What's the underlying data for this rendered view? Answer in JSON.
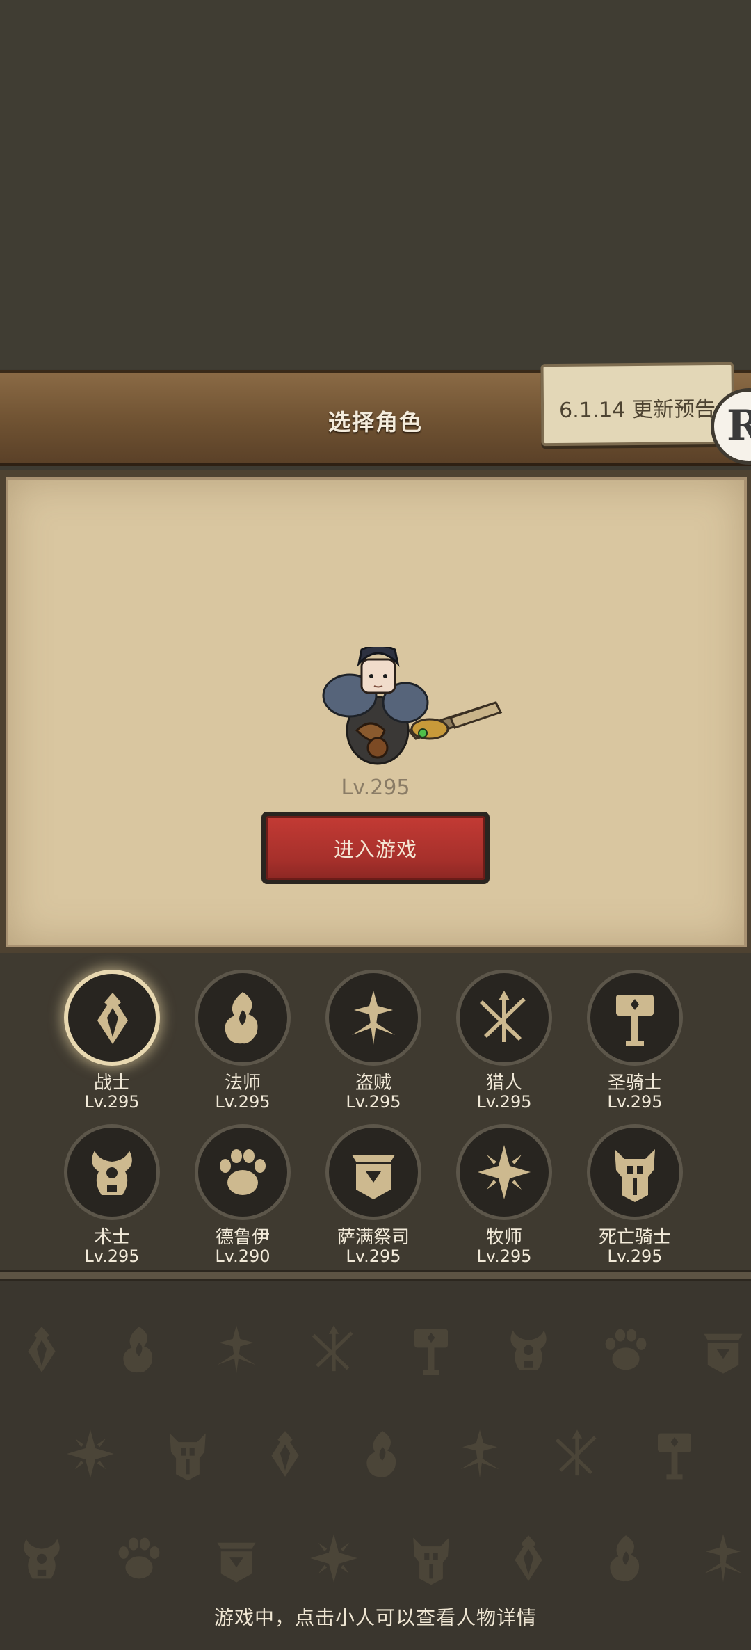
{
  "header": {
    "title": "选择角色"
  },
  "notice": {
    "label": "6.1.14 更新预告"
  },
  "corner_button": {
    "glyph": "R"
  },
  "hero": {
    "level": "Lv.295"
  },
  "enter_button": {
    "label": "进入游戏"
  },
  "classes": [
    {
      "name": "战士",
      "level": "Lv.295",
      "icon": "warrior-icon",
      "selected": true
    },
    {
      "name": "法师",
      "level": "Lv.295",
      "icon": "mage-icon",
      "selected": false
    },
    {
      "name": "盗贼",
      "level": "Lv.295",
      "icon": "rogue-icon",
      "selected": false
    },
    {
      "name": "猎人",
      "level": "Lv.295",
      "icon": "hunter-icon",
      "selected": false
    },
    {
      "name": "圣骑士",
      "level": "Lv.295",
      "icon": "paladin-icon",
      "selected": false
    },
    {
      "name": "术士",
      "level": "Lv.295",
      "icon": "warlock-icon",
      "selected": false
    },
    {
      "name": "德鲁伊",
      "level": "Lv.290",
      "icon": "druid-icon",
      "selected": false
    },
    {
      "name": "萨满祭司",
      "level": "Lv.295",
      "icon": "shaman-icon",
      "selected": false
    },
    {
      "name": "牧师",
      "level": "Lv.295",
      "icon": "priest-icon",
      "selected": false
    },
    {
      "name": "死亡骑士",
      "level": "Lv.295",
      "icon": "death-knight-icon",
      "selected": false
    }
  ],
  "footer": {
    "hint": "游戏中，点击小人可以查看人物详情"
  },
  "colors": {
    "accent_red": "#b3332e",
    "parchment": "#d9c6a0",
    "icon_gold": "#cdb98f"
  }
}
